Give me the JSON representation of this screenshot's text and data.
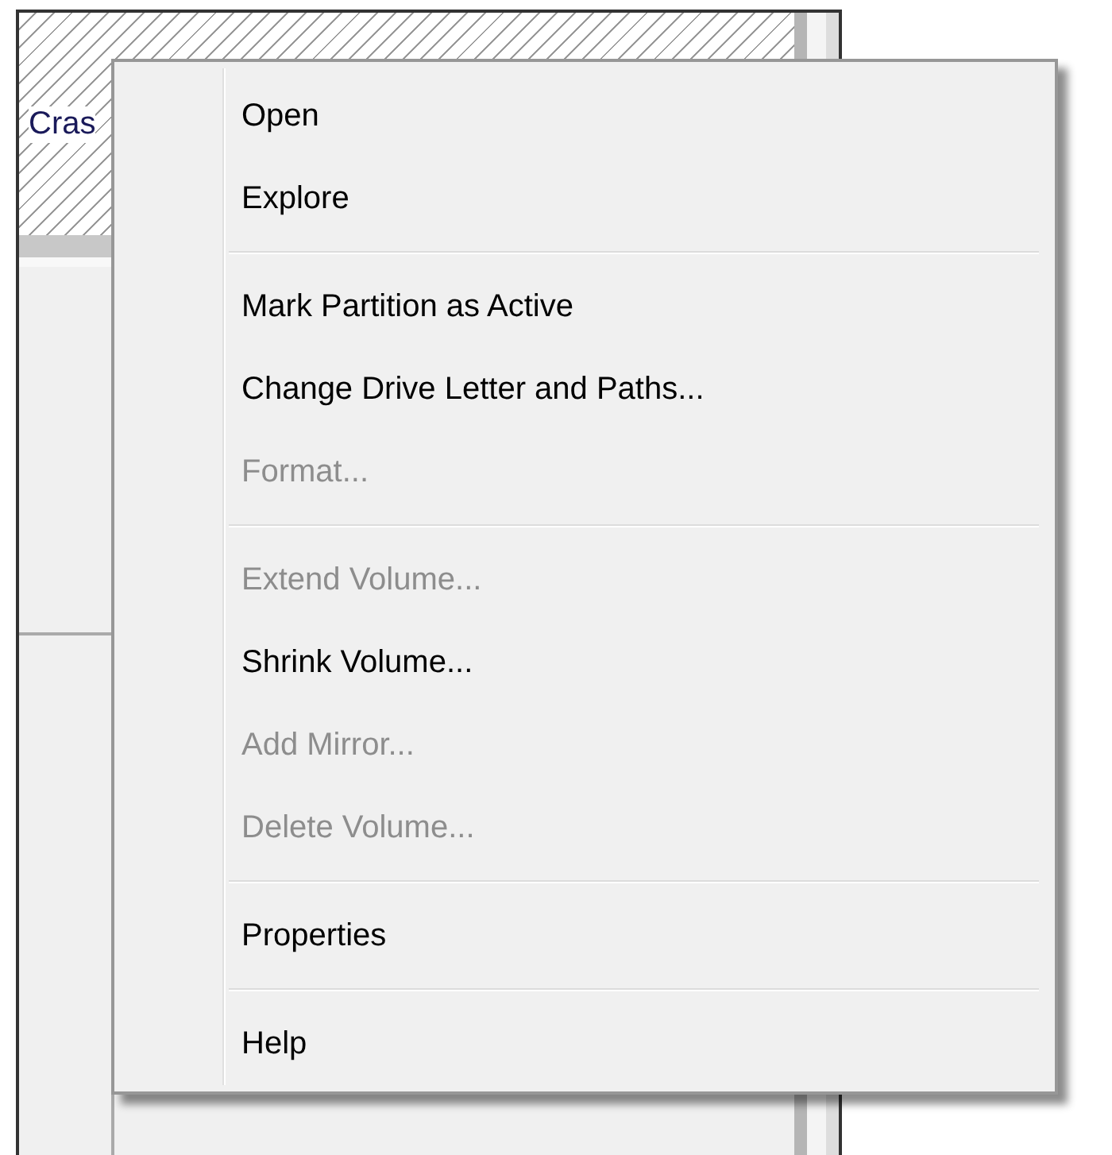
{
  "volume_block": {
    "label": "Cras"
  },
  "context_menu": {
    "items": [
      {
        "kind": "item",
        "label": "Open",
        "disabled": false
      },
      {
        "kind": "item",
        "label": "Explore",
        "disabled": false
      },
      {
        "kind": "separator"
      },
      {
        "kind": "item",
        "label": "Mark Partition as Active",
        "disabled": false
      },
      {
        "kind": "item",
        "label": "Change Drive Letter and Paths...",
        "disabled": false
      },
      {
        "kind": "item",
        "label": "Format...",
        "disabled": true
      },
      {
        "kind": "separator"
      },
      {
        "kind": "item",
        "label": "Extend Volume...",
        "disabled": true
      },
      {
        "kind": "item",
        "label": "Shrink Volume...",
        "disabled": false
      },
      {
        "kind": "item",
        "label": "Add Mirror...",
        "disabled": true
      },
      {
        "kind": "item",
        "label": "Delete Volume...",
        "disabled": true
      },
      {
        "kind": "separator"
      },
      {
        "kind": "item",
        "label": "Properties",
        "disabled": false
      },
      {
        "kind": "separator"
      },
      {
        "kind": "item",
        "label": "Help",
        "disabled": false
      }
    ]
  }
}
